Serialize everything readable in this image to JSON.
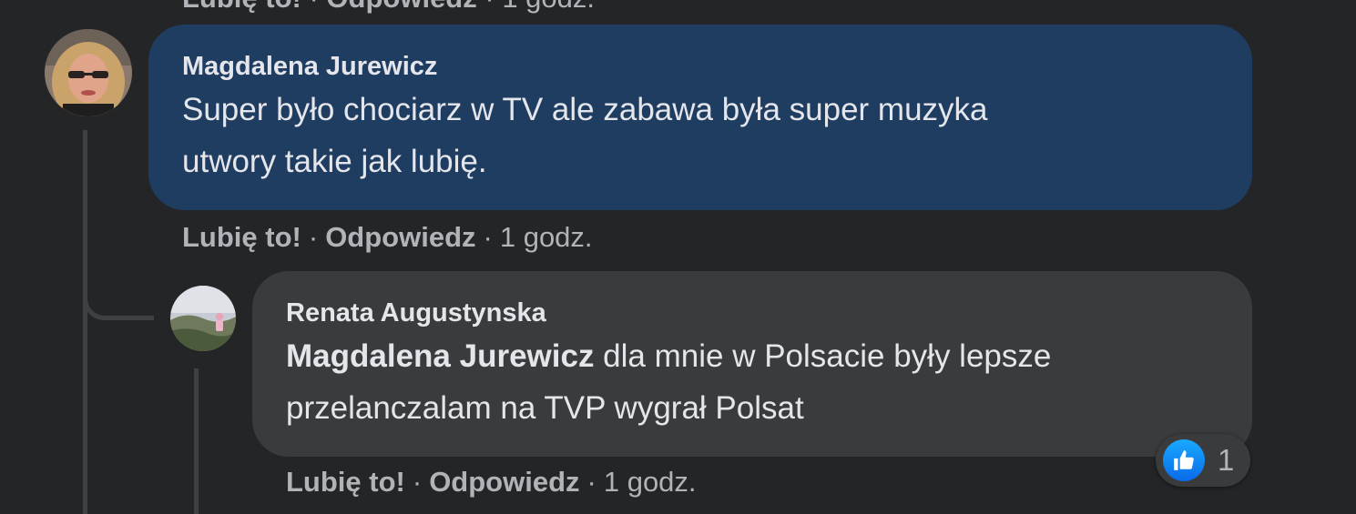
{
  "previous_comment_actions": {
    "like": "Lubię to!",
    "reply": "Odpowiedz",
    "time": "1 godz."
  },
  "comment": {
    "author": "Magdalena Jurewicz",
    "text_line1": "Super było chociarz w TV ale zabawa była super muzyka",
    "text_line2": "utwory takie jak lubię.",
    "actions": {
      "like": "Lubię to!",
      "reply": "Odpowiedz",
      "separator": "·",
      "time": "1 godz."
    }
  },
  "reply": {
    "author": "Renata Augustynska",
    "mention": "Magdalena Jurewicz",
    "text_line1_rest": " dla mnie w Polsacie były lepsze",
    "text_line2": "przelanczalam na TVP wygrał Polsat",
    "actions": {
      "like": "Lubię to!",
      "reply": "Odpowiedz",
      "separator": "·",
      "time": "1 godz."
    },
    "reaction": {
      "icon": "thumbs-up-icon",
      "count": "1"
    }
  },
  "colors": {
    "background": "#242526",
    "comment_bubble_highlighted": "#1f3c61",
    "comment_bubble": "#3a3b3c",
    "like_blue": "#1877f2",
    "secondary_text": "#b0b3b8"
  }
}
